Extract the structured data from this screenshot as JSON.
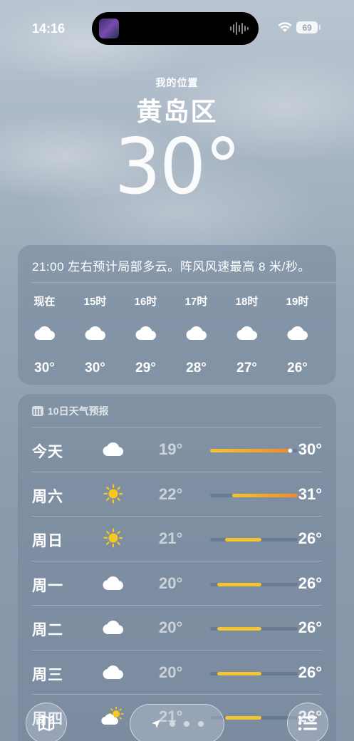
{
  "status_bar": {
    "time": "14:16",
    "battery": "69"
  },
  "header": {
    "subtitle": "我的位置",
    "location": "黄岛区",
    "temperature": "30°"
  },
  "hourly": {
    "summary": "21:00 左右预计局部多云。阵风风速最高 8 米/秒。",
    "hours": [
      {
        "label": "现在",
        "icon": "cloud-icon",
        "temp": "30°"
      },
      {
        "label": "15时",
        "icon": "cloud-icon",
        "temp": "30°"
      },
      {
        "label": "16时",
        "icon": "cloud-icon",
        "temp": "29°"
      },
      {
        "label": "17时",
        "icon": "cloud-icon",
        "temp": "28°"
      },
      {
        "label": "18时",
        "icon": "cloud-icon",
        "temp": "27°"
      },
      {
        "label": "19时",
        "icon": "cloud-icon",
        "temp": "26°"
      }
    ]
  },
  "daily": {
    "header": "10日天气预报",
    "range": {
      "min": 19,
      "max": 31
    },
    "current_temp": 30,
    "days": [
      {
        "name": "今天",
        "icon": "cloud-icon",
        "low": "19°",
        "high": "30°",
        "lo_val": 19,
        "hi_val": 30
      },
      {
        "name": "周六",
        "icon": "sun-icon",
        "low": "22°",
        "high": "31°",
        "lo_val": 22,
        "hi_val": 31
      },
      {
        "name": "周日",
        "icon": "sun-icon",
        "low": "21°",
        "high": "26°",
        "lo_val": 21,
        "hi_val": 26
      },
      {
        "name": "周一",
        "icon": "cloud-icon",
        "low": "20°",
        "high": "26°",
        "lo_val": 20,
        "hi_val": 26
      },
      {
        "name": "周二",
        "icon": "cloud-icon",
        "low": "20°",
        "high": "26°",
        "lo_val": 20,
        "hi_val": 26
      },
      {
        "name": "周三",
        "icon": "cloud-icon",
        "low": "20°",
        "high": "26°",
        "lo_val": 20,
        "hi_val": 26
      },
      {
        "name": "周四",
        "icon": "partly-sunny-icon",
        "low": "21°",
        "high": "26°",
        "lo_val": 21,
        "hi_val": 26
      }
    ]
  },
  "colors": {
    "bar_yellow": "#f2c531",
    "bar_orange": "#f08a2a",
    "sun": "#f7c81e"
  },
  "toolbar": {
    "map_icon": "map-icon",
    "location_icon": "location-arrow-icon",
    "list_icon": "list-icon",
    "page_count": 3
  }
}
